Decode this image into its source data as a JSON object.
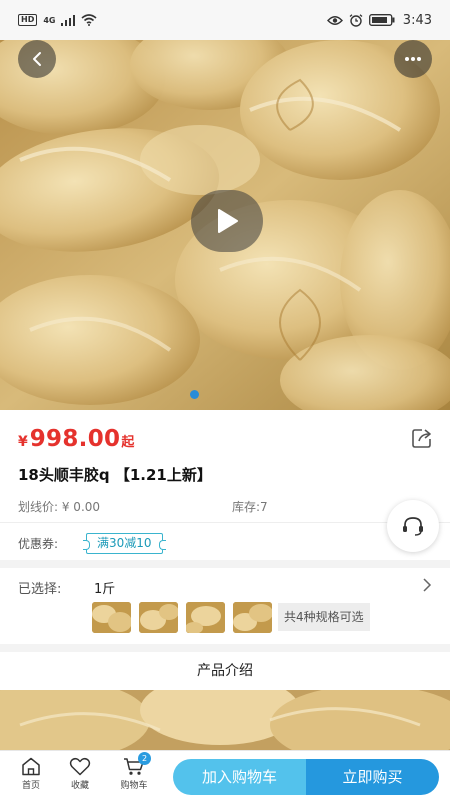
{
  "status_bar": {
    "hd_badge": "HD",
    "network": "4G",
    "time": "3:43",
    "icons": [
      "signal-icon",
      "wifi-icon",
      "eye-icon",
      "alarm-icon",
      "battery-icon"
    ]
  },
  "hero": {
    "carousel_page": 1,
    "media_type": "video",
    "icons": [
      "back-icon",
      "more-icon",
      "play-icon"
    ]
  },
  "product": {
    "currency": "¥",
    "price": "998.00",
    "price_suffix": "起",
    "title": "18头顺丰胶q 【1.21上新】",
    "original_price_label": "划线价: ¥ 0.00",
    "stock_label": "库存:7",
    "price_color": "#e5322d"
  },
  "coupon": {
    "label": "优惠券:",
    "tag": "满30减10"
  },
  "selection": {
    "label": "已选择:",
    "value": "1斤",
    "specs_count": "共4种规格可选",
    "thumbnail_count": 4
  },
  "intro": {
    "heading": "产品介绍"
  },
  "bottom_bar": {
    "home_label": "首页",
    "favorite_label": "收藏",
    "cart_label": "购物车",
    "cart_badge": "2",
    "add_to_cart_label": "加入购物车",
    "buy_now_label": "立即购买",
    "accent_light": "#53c2ec",
    "accent_dark": "#2598de"
  }
}
